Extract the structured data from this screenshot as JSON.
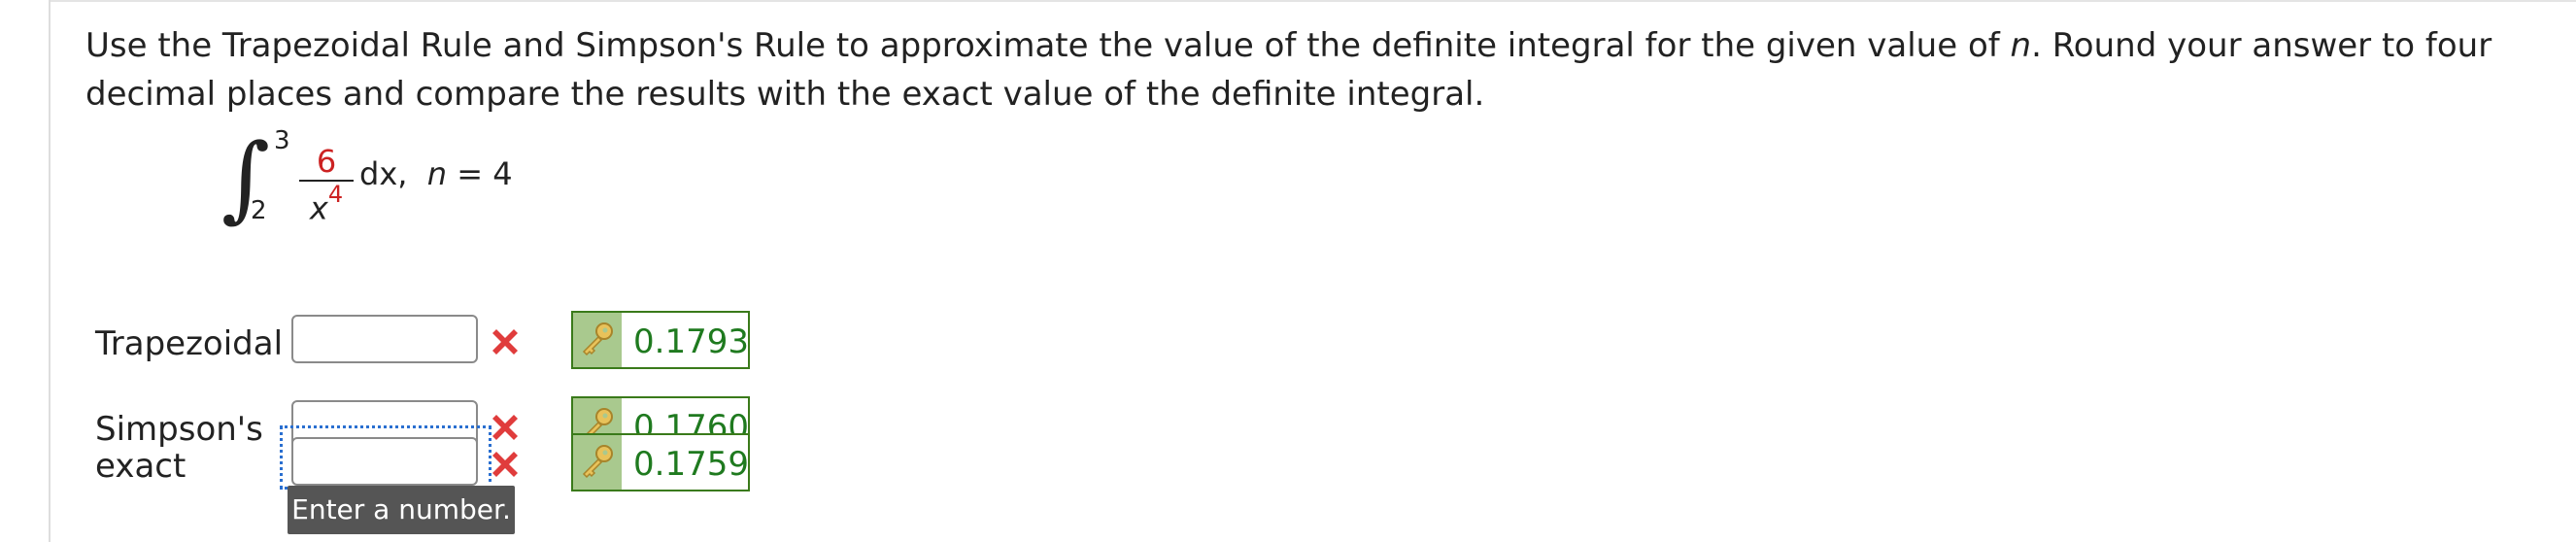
{
  "problem": {
    "part1": "Use the Trapezoidal Rule and Simpson's Rule to approximate the value of the definite integral for the given value of ",
    "var_n": "n",
    "part2": ". Round your answer to four decimal places and compare the results with the exact value of the definite integral."
  },
  "integral": {
    "upper": "3",
    "lower": "2",
    "numerator": "6",
    "denominator_base": "x",
    "denominator_exp": "4",
    "differential": "dx,",
    "n_var": "n",
    "n_eq": " = 4"
  },
  "rows": [
    {
      "label": "Trapezoidal",
      "input_value": "",
      "answer": "0.1793"
    },
    {
      "label": "Simpson's",
      "input_value": "",
      "answer": "0.1760"
    },
    {
      "label": "exact",
      "input_value": "",
      "answer": "0.1759"
    }
  ],
  "tooltip": {
    "text": "Enter a number."
  },
  "colors": {
    "incorrect": "#e03c3c",
    "answer_text": "#1f7a1f",
    "answer_border": "#3a7a1a",
    "key_cell": "#a9c98e",
    "focus": "#2a6fd0",
    "numerator": "#cc2222"
  },
  "icons": {
    "incorrect": "x-mark-icon",
    "answer_key": "key-icon"
  }
}
